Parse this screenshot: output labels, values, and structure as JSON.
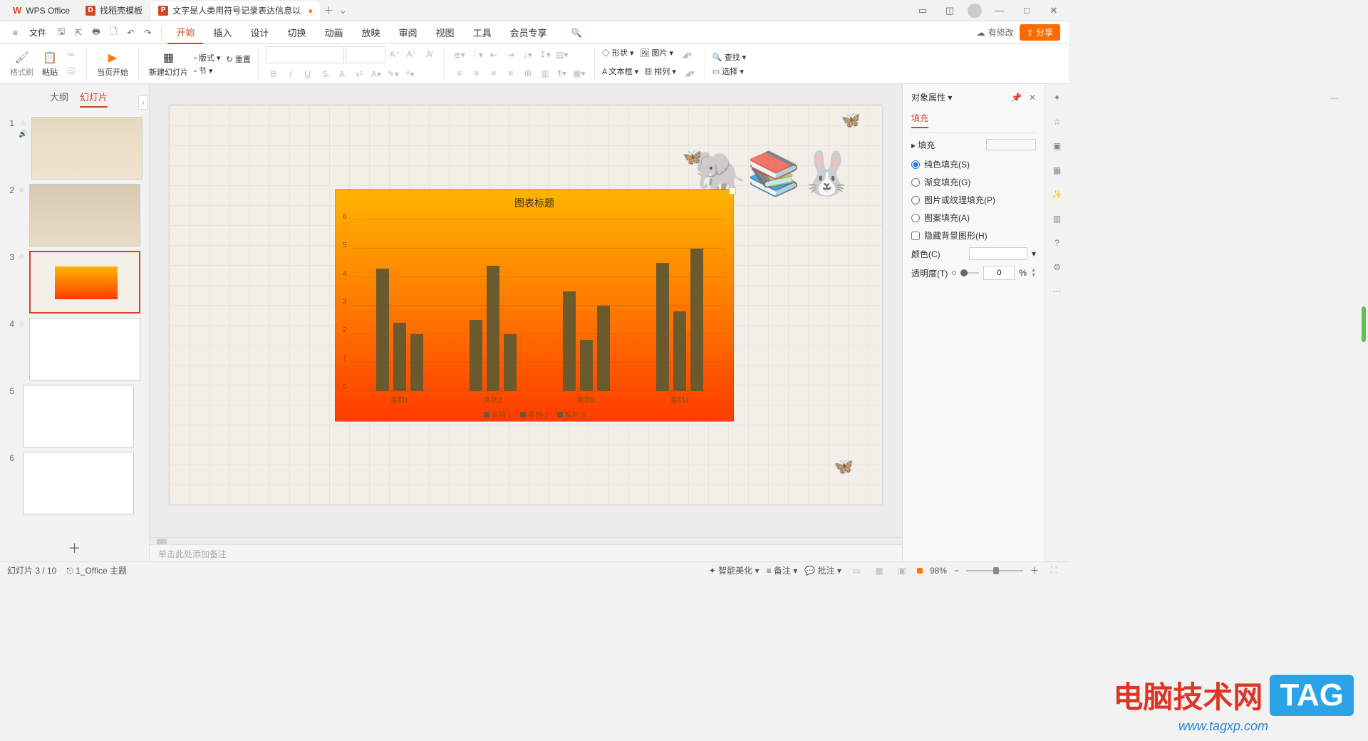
{
  "tabs": {
    "wps": "WPS Office",
    "docker": "找稻壳模板",
    "doc": "文字是人类用符号记录表达信息以"
  },
  "menu": {
    "file": "文件"
  },
  "ribbon": {
    "start": "开始",
    "insert": "插入",
    "design": "设计",
    "transition": "切换",
    "animation": "动画",
    "slideshow": "放映",
    "review": "审阅",
    "view": "视图",
    "tools": "工具",
    "member": "会员专享"
  },
  "topright": {
    "modified": "有修改",
    "share": "分享"
  },
  "tools": {
    "fmt_painter": "格式刷",
    "paste": "粘贴",
    "from_current": "当页开始",
    "new_slide": "新建幻灯片",
    "style": "版式",
    "reset": "重置",
    "section": "节",
    "shape": "形状",
    "picture": "图片",
    "textbox": "文本框",
    "arrange": "排列",
    "find": "查找",
    "select": "选择"
  },
  "panel": {
    "outline": "大纲",
    "slides": "幻灯片"
  },
  "notes_placeholder": "单击此处添加备注",
  "properties": {
    "title": "对象属性",
    "fill_tab": "填充",
    "fill_section": "填充",
    "solid": "纯色填充(S)",
    "gradient": "渐变填充(G)",
    "picture": "图片或纹理填充(P)",
    "pattern": "图案填充(A)",
    "hide_bg": "隐藏背景图形(H)",
    "color": "颜色(C)",
    "transparency": "透明度(T)",
    "trans_value": "0",
    "trans_unit": "%"
  },
  "status": {
    "slide_pos": "幻灯片 3 / 10",
    "theme": "1_Office 主题",
    "beautify": "智能美化",
    "remarks": "备注",
    "comments": "批注",
    "zoom": "98%"
  },
  "chart_data": {
    "type": "bar",
    "title": "图表标题",
    "categories": [
      "类别1",
      "类别2",
      "类别3",
      "类别4"
    ],
    "series": [
      {
        "name": "系列 1",
        "values": [
          4.3,
          2.5,
          3.5,
          4.5
        ]
      },
      {
        "name": "系列 2",
        "values": [
          2.4,
          4.4,
          1.8,
          2.8
        ]
      },
      {
        "name": "系列 3",
        "values": [
          2.0,
          2.0,
          3.0,
          5.0
        ]
      }
    ],
    "ylim": [
      0,
      6
    ],
    "yticks": [
      0,
      1,
      2,
      3,
      4,
      5,
      6
    ]
  },
  "watermark": {
    "text": "电脑技术网",
    "tag": "TAG",
    "url": "www.tagxp.com"
  }
}
